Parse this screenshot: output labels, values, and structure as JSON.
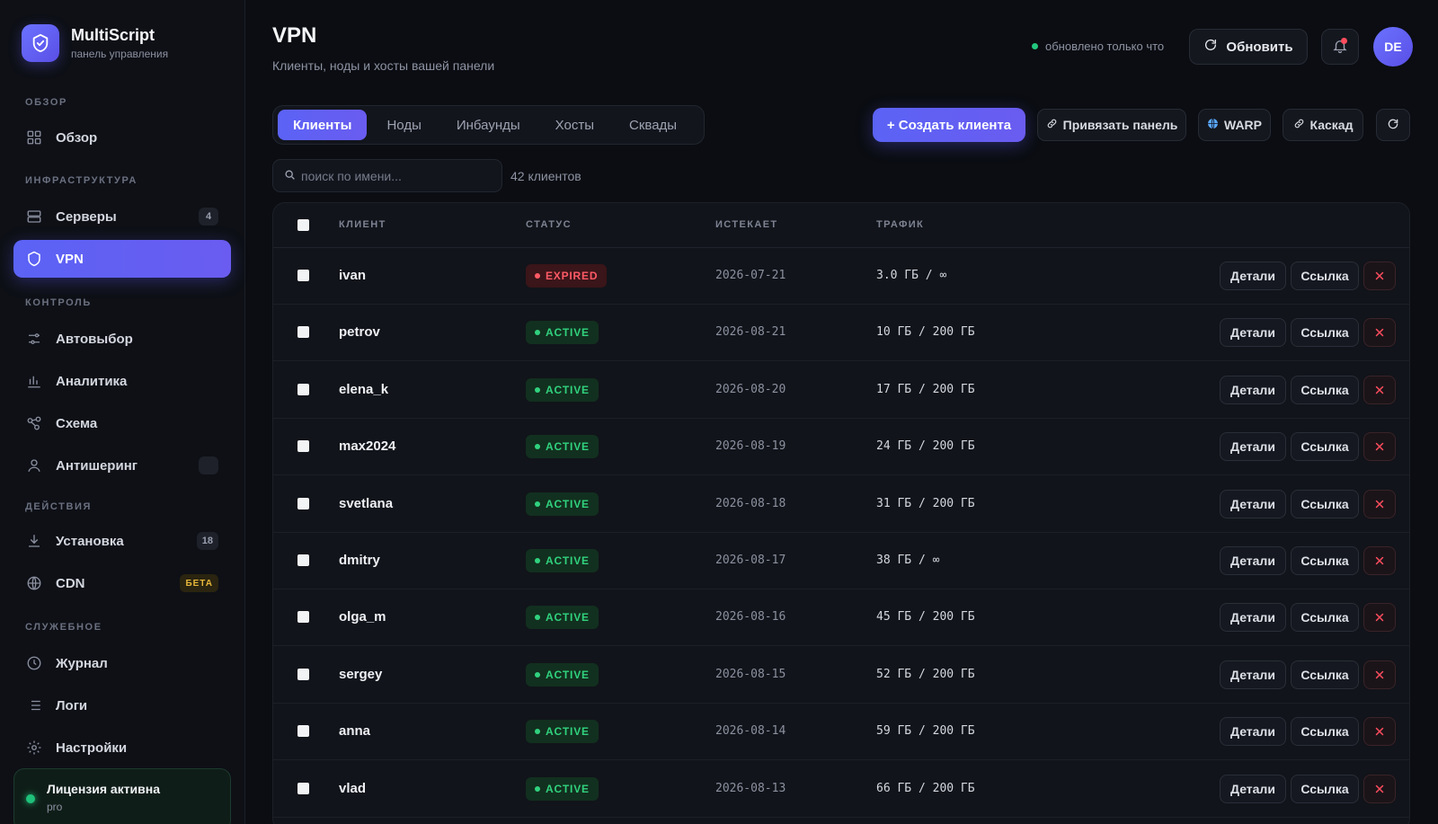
{
  "brand": {
    "title": "MultiScript",
    "subtitle": "панель управления"
  },
  "sidebar": {
    "sections": [
      {
        "label": "ОБЗОР"
      },
      {
        "label": "ИНФРАСТРУКТУРА"
      },
      {
        "label": "КОНТРОЛЬ"
      },
      {
        "label": "ДЕЙСТВИЯ"
      },
      {
        "label": "СЛУЖЕБНОЕ"
      }
    ],
    "items": [
      {
        "label": "Обзор",
        "icon": "grid-icon"
      },
      {
        "label": "Серверы",
        "icon": "server-icon",
        "badge": "4"
      },
      {
        "label": "VPN",
        "icon": "shield-icon",
        "active": true
      },
      {
        "label": "Автовыбор",
        "icon": "sliders-icon"
      },
      {
        "label": "Аналитика",
        "icon": "bar-chart-icon"
      },
      {
        "label": "Схема",
        "icon": "nodes-icon"
      },
      {
        "label": "Антишеринг",
        "icon": "user-icon",
        "badge": ""
      },
      {
        "label": "Установка",
        "icon": "download-icon",
        "badge": "18"
      },
      {
        "label": "CDN",
        "icon": "globe-icon",
        "badge": "БЕТА"
      },
      {
        "label": "Журнал",
        "icon": "clock-icon"
      },
      {
        "label": "Логи",
        "icon": "list-icon"
      },
      {
        "label": "Настройки",
        "icon": "gear-icon"
      }
    ],
    "license": {
      "title": "Лицензия активна",
      "plan": "pro"
    }
  },
  "header": {
    "title": "VPN",
    "subtitle": "Клиенты, ноды и хосты вашей панели",
    "updated_text": "обновлено только что",
    "refresh_label": "Обновить",
    "avatar_initials": "DE"
  },
  "tabs": [
    {
      "label": "Клиенты",
      "active": true
    },
    {
      "label": "Ноды"
    },
    {
      "label": "Инбаунды"
    },
    {
      "label": "Хосты"
    },
    {
      "label": "Сквады"
    }
  ],
  "toolbar": {
    "create_label": "+ Создать клиента",
    "bind_label": "Привязать панель",
    "warp_label": "WARP",
    "cascade_label": "Каскад"
  },
  "search": {
    "placeholder": "поиск по имени...",
    "count_text": "42 клиентов"
  },
  "table": {
    "columns": [
      "КЛИЕНТ",
      "СТАТУС",
      "ИСТЕКАЕТ",
      "ТРАФИК"
    ],
    "details_label": "Детали",
    "link_label": "Ссылка",
    "rows": [
      {
        "name": "ivan",
        "status": "EXPIRED",
        "expires": "2026-07-21",
        "traffic": "3.0 ГБ / ∞"
      },
      {
        "name": "petrov",
        "status": "ACTIVE",
        "expires": "2026-08-21",
        "traffic": "10 ГБ / 200 ГБ"
      },
      {
        "name": "elena_k",
        "status": "ACTIVE",
        "expires": "2026-08-20",
        "traffic": "17 ГБ / 200 ГБ"
      },
      {
        "name": "max2024",
        "status": "ACTIVE",
        "expires": "2026-08-19",
        "traffic": "24 ГБ / 200 ГБ"
      },
      {
        "name": "svetlana",
        "status": "ACTIVE",
        "expires": "2026-08-18",
        "traffic": "31 ГБ / 200 ГБ"
      },
      {
        "name": "dmitry",
        "status": "ACTIVE",
        "expires": "2026-08-17",
        "traffic": "38 ГБ / ∞"
      },
      {
        "name": "olga_m",
        "status": "ACTIVE",
        "expires": "2026-08-16",
        "traffic": "45 ГБ / 200 ГБ"
      },
      {
        "name": "sergey",
        "status": "ACTIVE",
        "expires": "2026-08-15",
        "traffic": "52 ГБ / 200 ГБ"
      },
      {
        "name": "anna",
        "status": "ACTIVE",
        "expires": "2026-08-14",
        "traffic": "59 ГБ / 200 ГБ"
      },
      {
        "name": "vlad",
        "status": "ACTIVE",
        "expires": "2026-08-13",
        "traffic": "66 ГБ / 200 ГБ"
      }
    ]
  },
  "colors": {
    "accent": "#5b63f5",
    "active": "#30d27e",
    "expired": "#ff5a66",
    "danger": "#ff4d5e"
  }
}
